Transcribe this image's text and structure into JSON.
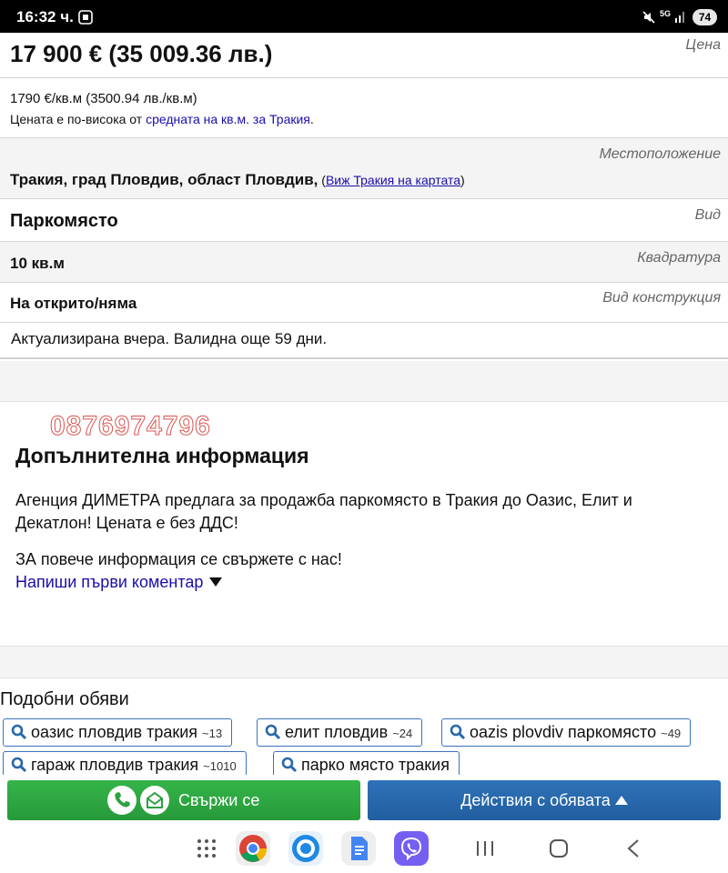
{
  "status_bar": {
    "time": "16:32 ч.",
    "battery": "74",
    "network": "5G"
  },
  "listing": {
    "price": "17 900 € (35 009.36 лв.)",
    "price_label": "Цена",
    "price_per_sqm": "1790 €/кв.м (3500.94 лв./кв.м)",
    "price_note_prefix": "Цената е по-висока от ",
    "price_note_link": "средната на кв.м. за Тракия",
    "price_note_suffix": ".",
    "location_label": "Местоположение",
    "location_value": "Тракия, град Пловдив, област Пловдив,",
    "location_open_paren": " (",
    "location_map_link": "Виж Тракия на картата",
    "location_close_paren": ")",
    "type_label": "Вид",
    "type_value": "Паркомясто",
    "area_label": "Квадратура",
    "area_value": "10 кв.м",
    "construction_label": "Вид конструкция",
    "construction_value": "На открито/няма",
    "updated_text": "Актуализирана вчера. Валидна още 59 дни."
  },
  "details": {
    "phone_watermark": "0876974796",
    "title": "Допълнителна информация",
    "description_1": "Агенция ДИМЕТРА предлага за продажба паркомясто в Тракия до Оазис, Елит и Декатлон! Цената е без ДДС!",
    "description_2": "ЗА повече информация се свържете с нас!",
    "comment_link": "Напиши първи коментар"
  },
  "similar": {
    "title": "Подобни обяви",
    "tags": [
      {
        "label": "оазис пловдив тракия",
        "count": "~13"
      },
      {
        "label": "елит пловдив",
        "count": "~24"
      },
      {
        "label": "oazis plovdiv паркомясто",
        "count": "~49"
      },
      {
        "label": "гараж пловдив тракия",
        "count": "~1010"
      },
      {
        "label": "парко място тракия",
        "count": ""
      }
    ]
  },
  "actions": {
    "contact_label": "Свържи се",
    "actions_label": "Действия с обявата"
  },
  "colors": {
    "link": "#1a0dab",
    "contact_green": "#2ea043",
    "actions_blue": "#2a67ab",
    "tag_border": "#3b73b9"
  },
  "nav_apps": [
    "apps-grid-icon",
    "chrome-icon",
    "browser-icon",
    "docs-icon",
    "viber-icon"
  ]
}
